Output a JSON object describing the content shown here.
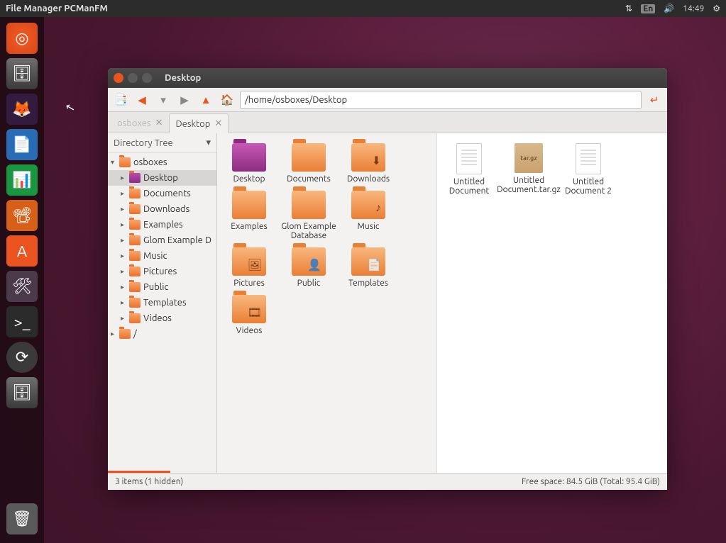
{
  "topbar": {
    "title": "File Manager PCManFM",
    "lang": "En",
    "time": "14:49"
  },
  "launcher": [
    {
      "name": "ubuntu-dash",
      "glyph": "◎",
      "cls": "ubuntu"
    },
    {
      "name": "file-manager",
      "glyph": "🗄",
      "cls": "files"
    },
    {
      "name": "firefox",
      "glyph": "🦊",
      "cls": "firefox"
    },
    {
      "name": "libreoffice-writer",
      "glyph": "📄",
      "cls": "writer"
    },
    {
      "name": "libreoffice-calc",
      "glyph": "📊",
      "cls": "calc"
    },
    {
      "name": "libreoffice-impress",
      "glyph": "📽",
      "cls": "impress"
    },
    {
      "name": "ubuntu-software",
      "glyph": "A",
      "cls": "software"
    },
    {
      "name": "system-settings",
      "glyph": "🛠",
      "cls": "settings"
    },
    {
      "name": "terminal",
      "glyph": ">_",
      "cls": "terminal"
    },
    {
      "name": "software-updater",
      "glyph": "⟳",
      "cls": "updater"
    },
    {
      "name": "file-manager-2",
      "glyph": "🗄",
      "cls": "files"
    }
  ],
  "window_title": "Desktop",
  "path": "/home/osboxes/Desktop",
  "tabs": [
    {
      "label": "osboxes",
      "active": false
    },
    {
      "label": "Desktop",
      "active": true
    }
  ],
  "sidebar": {
    "header": "Directory Tree",
    "nodes": [
      {
        "label": "osboxes",
        "level": 0,
        "expanded": true,
        "cls": ""
      },
      {
        "label": "Desktop",
        "level": 1,
        "expanded": false,
        "cls": "desktop",
        "selected": true
      },
      {
        "label": "Documents",
        "level": 1,
        "expanded": false
      },
      {
        "label": "Downloads",
        "level": 1,
        "expanded": false
      },
      {
        "label": "Examples",
        "level": 1,
        "expanded": false
      },
      {
        "label": "Glom Example D",
        "level": 1,
        "expanded": false
      },
      {
        "label": "Music",
        "level": 1,
        "expanded": false
      },
      {
        "label": "Pictures",
        "level": 1,
        "expanded": false
      },
      {
        "label": "Public",
        "level": 1,
        "expanded": false
      },
      {
        "label": "Templates",
        "level": 1,
        "expanded": false
      },
      {
        "label": "Videos",
        "level": 1,
        "expanded": false
      },
      {
        "label": "/",
        "level": 0,
        "expanded": false
      }
    ]
  },
  "left_pane": [
    {
      "label": "Desktop",
      "type": "folder",
      "cls": "desktop",
      "overlay": ""
    },
    {
      "label": "Documents",
      "type": "folder",
      "overlay": ""
    },
    {
      "label": "Downloads",
      "type": "folder",
      "overlay": "⬇"
    },
    {
      "label": "Examples",
      "type": "folder",
      "overlay": ""
    },
    {
      "label": "Glom Example Database",
      "type": "folder",
      "overlay": ""
    },
    {
      "label": "Music",
      "type": "folder",
      "overlay": "♪"
    },
    {
      "label": "Pictures",
      "type": "folder",
      "overlay": "🖼"
    },
    {
      "label": "Public",
      "type": "folder",
      "overlay": "👤"
    },
    {
      "label": "Templates",
      "type": "folder",
      "overlay": "📄"
    },
    {
      "label": "Videos",
      "type": "folder",
      "overlay": "🎞"
    }
  ],
  "right_pane": [
    {
      "label": "Untitled Document",
      "type": "doc"
    },
    {
      "label": "Untitled Document.tar.gz",
      "type": "tar"
    },
    {
      "label": "Untitled Document 2",
      "type": "doc"
    }
  ],
  "status": {
    "left": "3 items (1 hidden)",
    "right": "Free space: 84.5 GiB (Total: 95.4 GiB)"
  }
}
